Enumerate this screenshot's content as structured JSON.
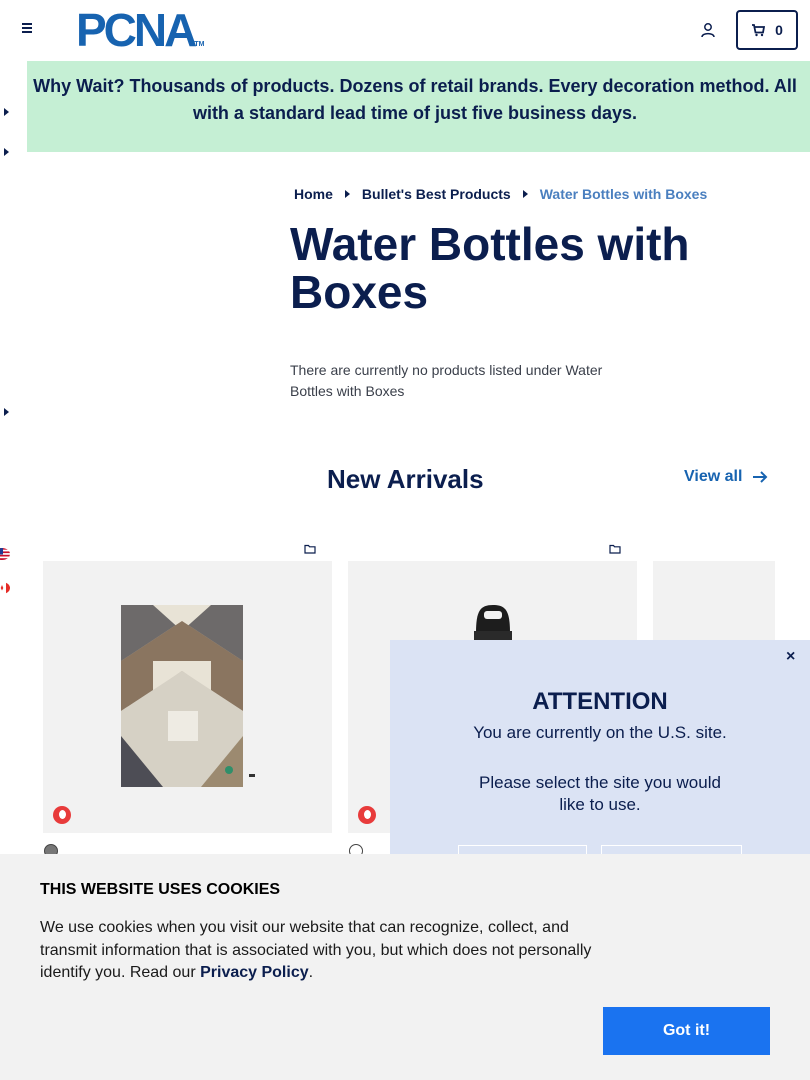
{
  "header": {
    "logo_text": "PCNA",
    "logo_tm": "TM",
    "cart_count": "0"
  },
  "banner": {
    "text": "Why Wait? Thousands of products. Dozens of retail brands. Every decoration method. All with a standard lead time of just five business days.",
    "background": "#c5efd4"
  },
  "breadcrumb": {
    "items": [
      "Home",
      "Bullet's Best Products",
      "Water Bottles with Boxes"
    ]
  },
  "page": {
    "title": "Water Bottles with Boxes",
    "empty_message": "There are currently no products listed under Water Bottles with Boxes"
  },
  "new_arrivals": {
    "title": "New Arrivals",
    "view_all": "View all"
  },
  "attention": {
    "close": "×",
    "title": "ATTENTION",
    "line1": "You are currently on the U.S. site.",
    "line2": "Please select the site you would like to use."
  },
  "cookie": {
    "title": "THIS WEBSITE USES COOKIES",
    "text_before": "We use cookies when you visit our website that can recognize, collect, and transmit information that is associated with you, but which does not personally identify you. Read our ",
    "link": "Privacy Policy",
    "text_after": ".",
    "button": "Got it!"
  },
  "colors": {
    "brand_navy": "#0b1e4e",
    "brand_blue": "#1763b0",
    "button_blue": "#1a73f0",
    "modal_bg": "#dbe3f4"
  }
}
